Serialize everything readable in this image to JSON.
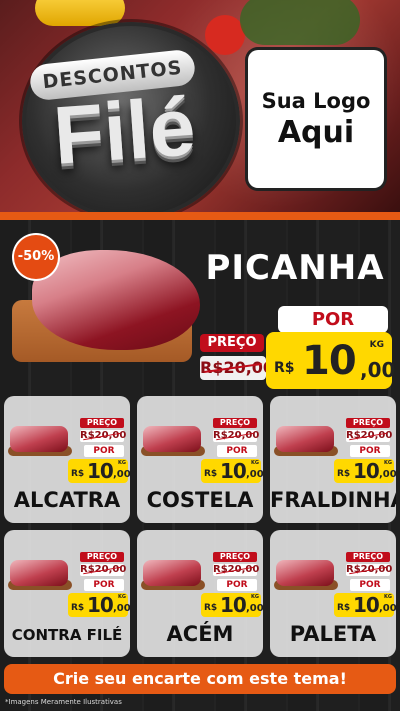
{
  "header": {
    "badge_top": "DESCONTOS",
    "badge_main": "Filé",
    "logo_line1": "Sua Logo",
    "logo_line2": "Aqui"
  },
  "featured": {
    "discount": "-50%",
    "title": "PICANHA",
    "preco_label": "PREÇO",
    "old_price": "R$20,00",
    "por_label": "POR",
    "currency": "R$",
    "price_int": "10",
    "price_dec": ",00",
    "unit": "KG"
  },
  "products": [
    {
      "name": "ALCATRA",
      "preco_label": "PREÇO",
      "old_price": "R$20,00",
      "por_label": "POR",
      "currency": "R$",
      "price_int": "10",
      "price_dec": ",00",
      "unit": "KG"
    },
    {
      "name": "COSTELA",
      "preco_label": "PREÇO",
      "old_price": "R$20,00",
      "por_label": "POR",
      "currency": "R$",
      "price_int": "10",
      "price_dec": ",00",
      "unit": "KG"
    },
    {
      "name": "FRALDINHA",
      "preco_label": "PREÇO",
      "old_price": "R$20,00",
      "por_label": "POR",
      "currency": "R$",
      "price_int": "10",
      "price_dec": ",00",
      "unit": "KG"
    },
    {
      "name": "CONTRA FILÉ",
      "preco_label": "PREÇO",
      "old_price": "R$20,00",
      "por_label": "POR",
      "currency": "R$",
      "price_int": "10",
      "price_dec": ",00",
      "unit": "KG"
    },
    {
      "name": "ACÉM",
      "preco_label": "PREÇO",
      "old_price": "R$20,00",
      "por_label": "POR",
      "currency": "R$",
      "price_int": "10",
      "price_dec": ",00",
      "unit": "KG"
    },
    {
      "name": "PALETA",
      "preco_label": "PREÇO",
      "old_price": "R$20,00",
      "por_label": "POR",
      "currency": "R$",
      "price_int": "10",
      "price_dec": ",00",
      "unit": "KG"
    }
  ],
  "cta": {
    "label": "Crie seu encarte com este tema!"
  },
  "footnote": "*Imagens Meramente Ilustrativas",
  "colors": {
    "accent": "#e65a14",
    "price_bg": "#ffd800",
    "red": "#c10d1b"
  }
}
